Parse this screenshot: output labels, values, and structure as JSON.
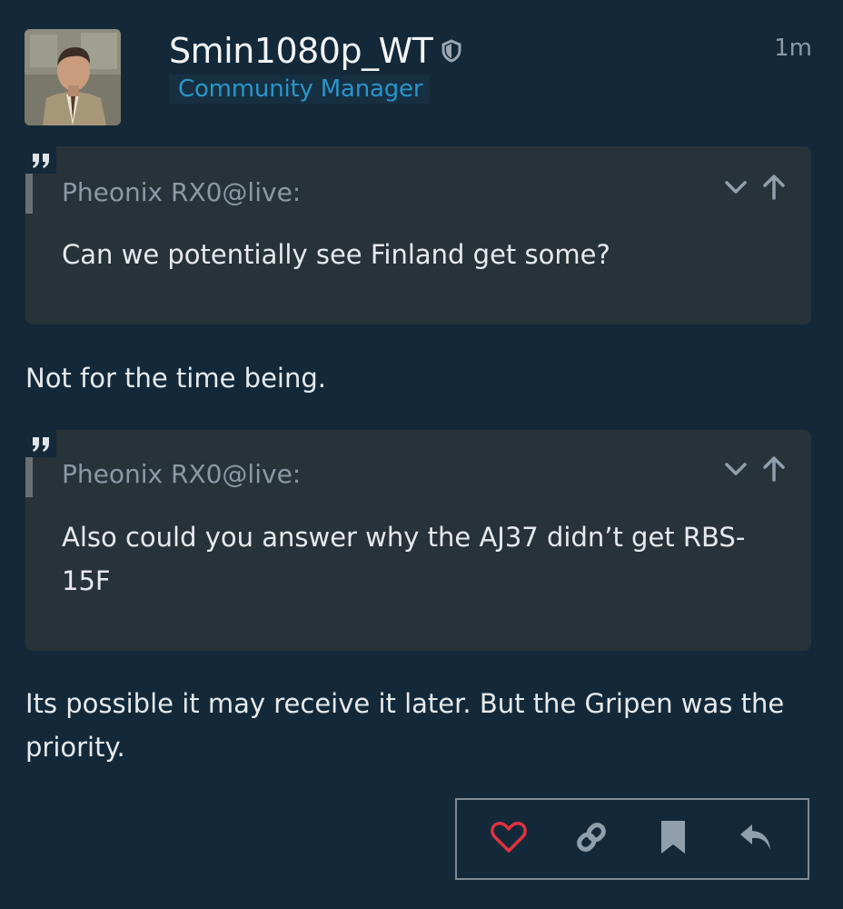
{
  "post": {
    "username": "Smin1080p_WT",
    "role": "Community Manager",
    "timestamp": "1m",
    "quotes": [
      {
        "author": "Pheonix RX0@live:",
        "text": "Can we potentially see Finland get some?"
      },
      {
        "author": "Pheonix RX0@live:",
        "text": "Also could you answer why the AJ37 didn’t get RBS-15F"
      }
    ],
    "replies": [
      "Not for the time being.",
      "Its possible it may receive it later. But the Gripen was the priority."
    ]
  },
  "icons": {
    "moderator": "shield-icon",
    "quote": "quote-icon",
    "expand": "chevron-down-icon",
    "jump": "arrow-up-icon",
    "like": "heart-icon",
    "link": "link-icon",
    "bookmark": "bookmark-icon",
    "reply": "reply-icon"
  },
  "colors": {
    "background": "#13293a",
    "quote_background": "#283239",
    "role": "#2a95c8",
    "like": "#e0323f",
    "muted_icon": "#8fa0ac"
  }
}
